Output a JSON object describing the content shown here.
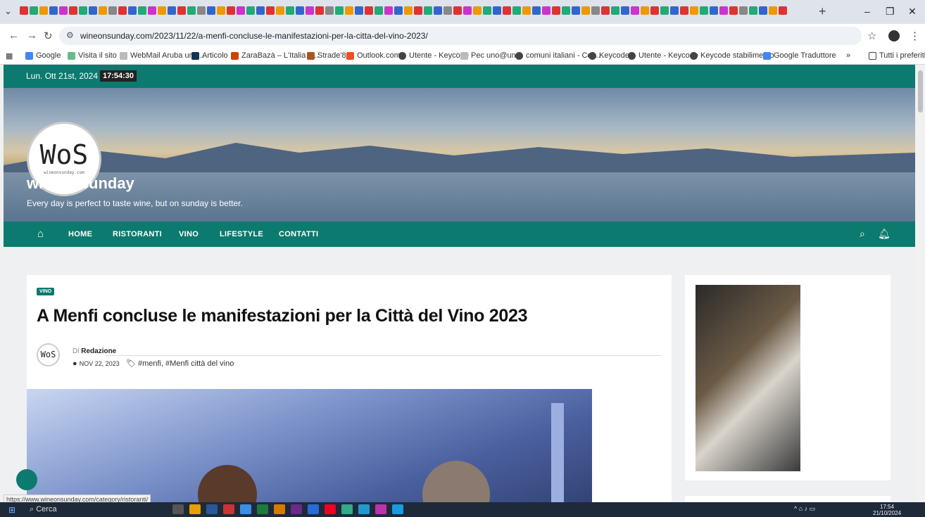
{
  "browser": {
    "url": "wineonsunday.com/2023/11/22/a-menfi-concluse-le-manifestazioni-per-la-citta-del-vino-2023/",
    "status_url": "https://www.wineonsunday.com/category/ristoranti/",
    "bookmarks": [
      "Google",
      "Visita il sito",
      "WebMail Aruba uno...",
      "Articolo",
      "ZaraBazà – L'Italia d...",
      "Strade'89",
      "Outlook.com",
      "Utente - Keycode",
      "Pec uno@uno",
      "comuni italiani - Cer...",
      "Keycode",
      "Utente - Keycode",
      "Keycode stabilimento",
      "Google Traduttore"
    ],
    "bookmarks_more": "»",
    "all_bookmarks": "Tutti i preferiti"
  },
  "site": {
    "date": "Lun. Ott 21st, 2024",
    "clock": "17:54:30",
    "logo_text": "WoS",
    "logo_sub": "wineonsunday.com",
    "name": "wineonsunday",
    "tagline": "Every day is perfect to taste wine, but on sunday is better.",
    "nav": [
      "HOME",
      "RISTORANTI",
      "VINO",
      "LIFESTYLE",
      "CONTATTI"
    ]
  },
  "article": {
    "category": "VINO",
    "title": "A Menfi concluse le manifestazioni per la Città del Vino 2023",
    "by_prefix": "Di",
    "author": "Redazione",
    "date": "NOV 22, 2023",
    "tags": "#menfi, #Menfi città del vino",
    "avatar_text": "WoS"
  },
  "taskbar": {
    "search": "Cerca",
    "time": "17:54",
    "date": "21/10/2024"
  }
}
